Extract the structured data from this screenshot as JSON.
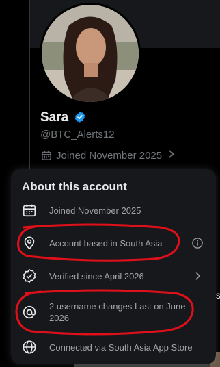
{
  "profile": {
    "name": "Sara",
    "handle": "@BTC_Alerts12",
    "joined": "Joined November 2025"
  },
  "about": {
    "title": "About this account",
    "rows": [
      {
        "icon": "calendar-icon",
        "text": "Joined November 2025"
      },
      {
        "icon": "location-pin-icon",
        "text": "Account based in South Asia",
        "right_icon": "info-icon"
      },
      {
        "icon": "verified-check-icon",
        "text": "Verified since April 2026",
        "right_icon": "chevron-right-icon"
      },
      {
        "icon": "at-sign-icon",
        "text_line1": "2 username changes Last on June",
        "text_line2": "2026"
      },
      {
        "icon": "globe-icon",
        "text": "Connected via South Asia App Store"
      }
    ]
  },
  "partial": {
    "right_edge_text": "s"
  },
  "colors": {
    "background": "#000000",
    "panel": "#16181c",
    "verified_blue": "#1d9bf0",
    "annotation_red": "#e0101a",
    "muted_text": "#71767b"
  }
}
